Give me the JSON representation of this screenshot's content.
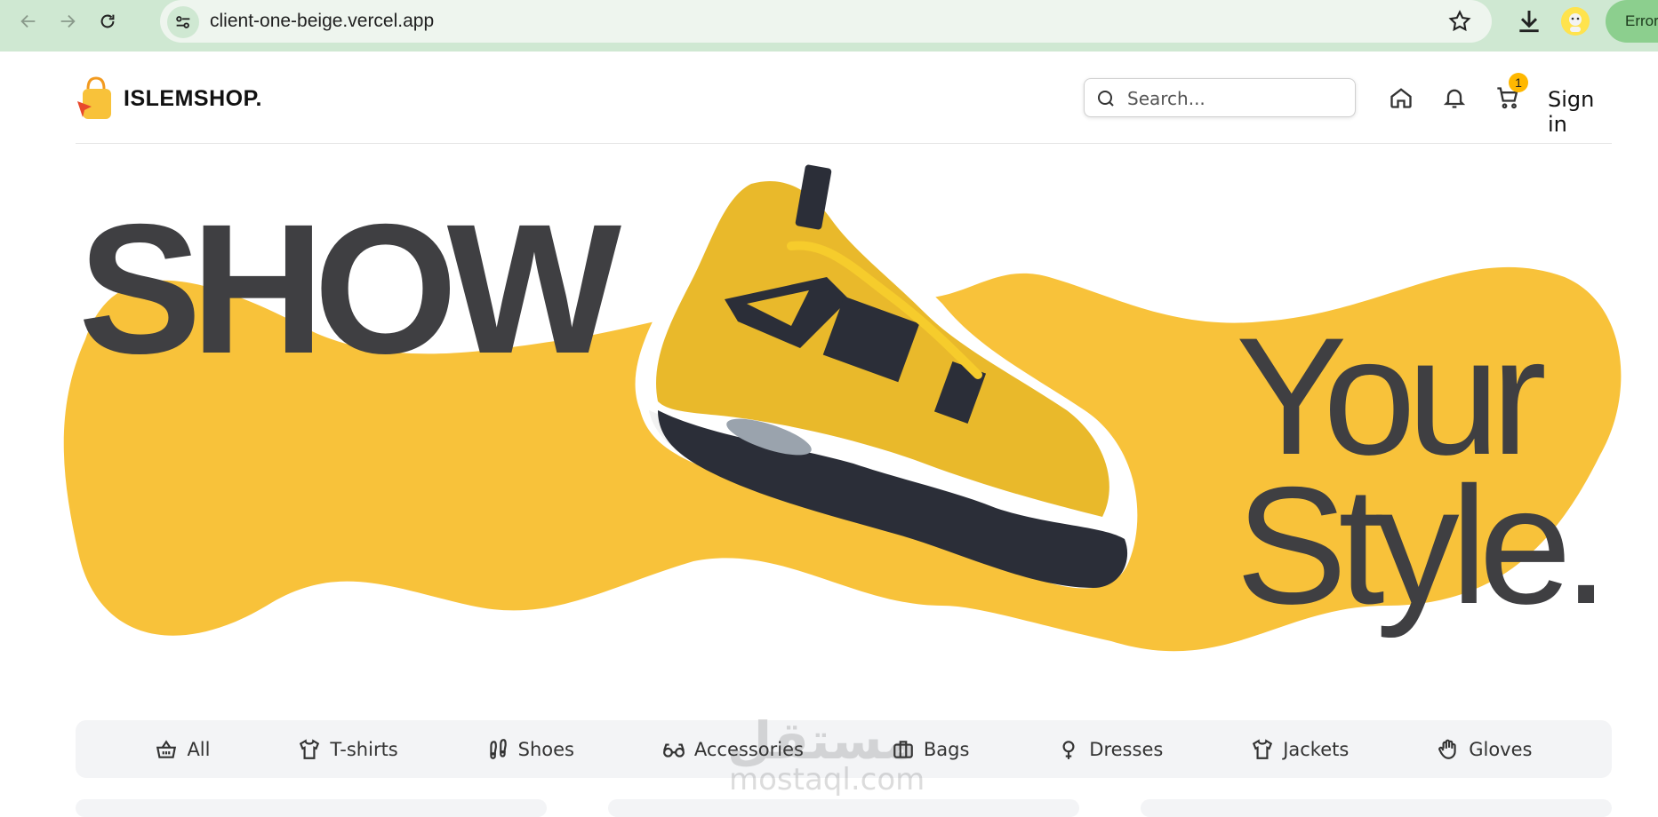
{
  "browser": {
    "url": "client-one-beige.vercel.app",
    "status_label": "Error"
  },
  "header": {
    "brand": "ISLEMSHOP.",
    "search_placeholder": "Search...",
    "cart_count": "1",
    "signin_label": "Sign in"
  },
  "hero": {
    "line1": "SHOW",
    "line2": "Your",
    "line3": "Style."
  },
  "categories": [
    {
      "label": "All",
      "icon": "basket-icon"
    },
    {
      "label": "T-shirts",
      "icon": "tshirt-icon"
    },
    {
      "label": "Shoes",
      "icon": "footprints-icon"
    },
    {
      "label": "Accessories",
      "icon": "glasses-icon"
    },
    {
      "label": "Bags",
      "icon": "briefcase-icon"
    },
    {
      "label": "Dresses",
      "icon": "venus-icon"
    },
    {
      "label": "Jackets",
      "icon": "shirt-icon"
    },
    {
      "label": "Gloves",
      "icon": "hand-icon"
    }
  ],
  "watermark": {
    "arabic": "مستقل",
    "latin": "mostaql.com"
  },
  "colors": {
    "accent": "#f8c23a",
    "text_dark": "#3f3f42",
    "chrome": "#cfe8d2"
  }
}
